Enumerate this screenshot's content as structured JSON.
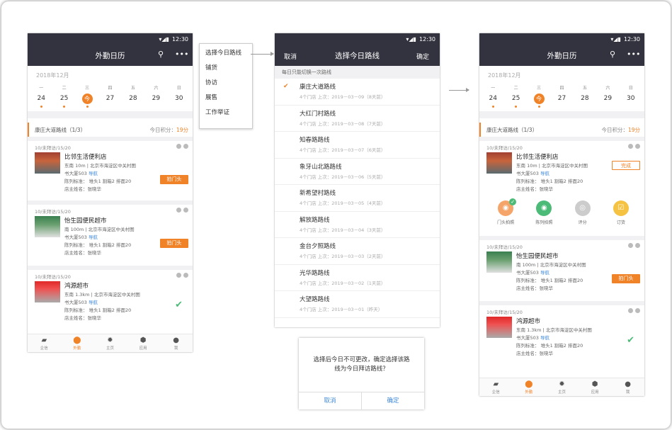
{
  "status": {
    "time": "12:30"
  },
  "cal": {
    "title": "外勤日历",
    "month": "2018年12月",
    "weekdays": [
      "一",
      "二",
      "三",
      "四",
      "五",
      "六",
      "日"
    ],
    "dates": [
      "24",
      "25",
      "今",
      "27",
      "28",
      "29",
      "30"
    ]
  },
  "route": {
    "name": "康庄大道路线（1/3）",
    "score_label": "今日积分：",
    "score": "19分"
  },
  "stores": [
    {
      "visits": "10/未拜访/15/20",
      "name": "比邻生活便利店",
      "dist": "东南 10m | 北京市海淀区中关村图",
      "addr": "书大厦503",
      "nav": "导航",
      "std": "陈列标准：  堆头1    割箱2    排面20",
      "owner": "店主姓名：张晓华"
    },
    {
      "visits": "10/未拜访/15/20",
      "name": "怡生园便民超市",
      "dist": "南 100m | 北京市海淀区中关村图",
      "addr": "书大厦503",
      "nav": "导航",
      "std": "陈列标准：  堆头1    割箱2    排面20",
      "owner": "店主姓名：张晓华"
    },
    {
      "visits": "10/未拜访/15/20",
      "name": "鸿源超市",
      "dist": "东南 1.3km | 北京市海淀区中关村图",
      "addr": "书大厦503",
      "nav": "导航",
      "std": "陈列标准：  堆头1    割箱2    排面20",
      "owner": "店主姓名：张晓华"
    }
  ],
  "btn": {
    "photo": "拍门头",
    "done": "完成"
  },
  "actions": [
    "门头拍照",
    "陈列拍照",
    "评分",
    "订货"
  ],
  "tabs": [
    "企信",
    "外勤",
    "主页",
    "应用",
    "我"
  ],
  "menu": [
    "选择今日路线",
    "铺货",
    "协访",
    "展售",
    "工作举证"
  ],
  "picker": {
    "cancel": "取消",
    "title": "选择今日路线",
    "ok": "确定",
    "notice": "每日只能切换一次路线",
    "routes": [
      {
        "name": "康庄大道路线",
        "sub": "4个门店   上次：2019－03－09（8天前）"
      },
      {
        "name": "大红门村路线",
        "sub": "4个门店   上次：2019－03－08（7天前）"
      },
      {
        "name": "知春路路线",
        "sub": "4个门店   上次：2019－03－07（6天前）"
      },
      {
        "name": "象牙山北路路线",
        "sub": "4个门店   上次：2019－03－06（5天前）"
      },
      {
        "name": "新希望村路线",
        "sub": "4个门店   上次：2019－03－05（4天前）"
      },
      {
        "name": "解放路路线",
        "sub": "4个门店   上次：2019－03－04（3天前）"
      },
      {
        "name": "金台夕照路线",
        "sub": "4个门店   上次：2019－03－03（2天前）"
      },
      {
        "name": "光华路路线",
        "sub": "4个门店   上次：2019－03－02（1天前）"
      },
      {
        "name": "大望路路线",
        "sub": "4个门店   上次：2019－03－01（昨天）"
      }
    ]
  },
  "dialog": {
    "msg": "选择后今日不可更改，确定选择该路线为今日拜访路线？",
    "cancel": "取消",
    "ok": "确定"
  },
  "colors": {
    "accent": "#f08228",
    "bar": "#33333f",
    "link": "#3f88d8",
    "green": "#4cbb77"
  }
}
